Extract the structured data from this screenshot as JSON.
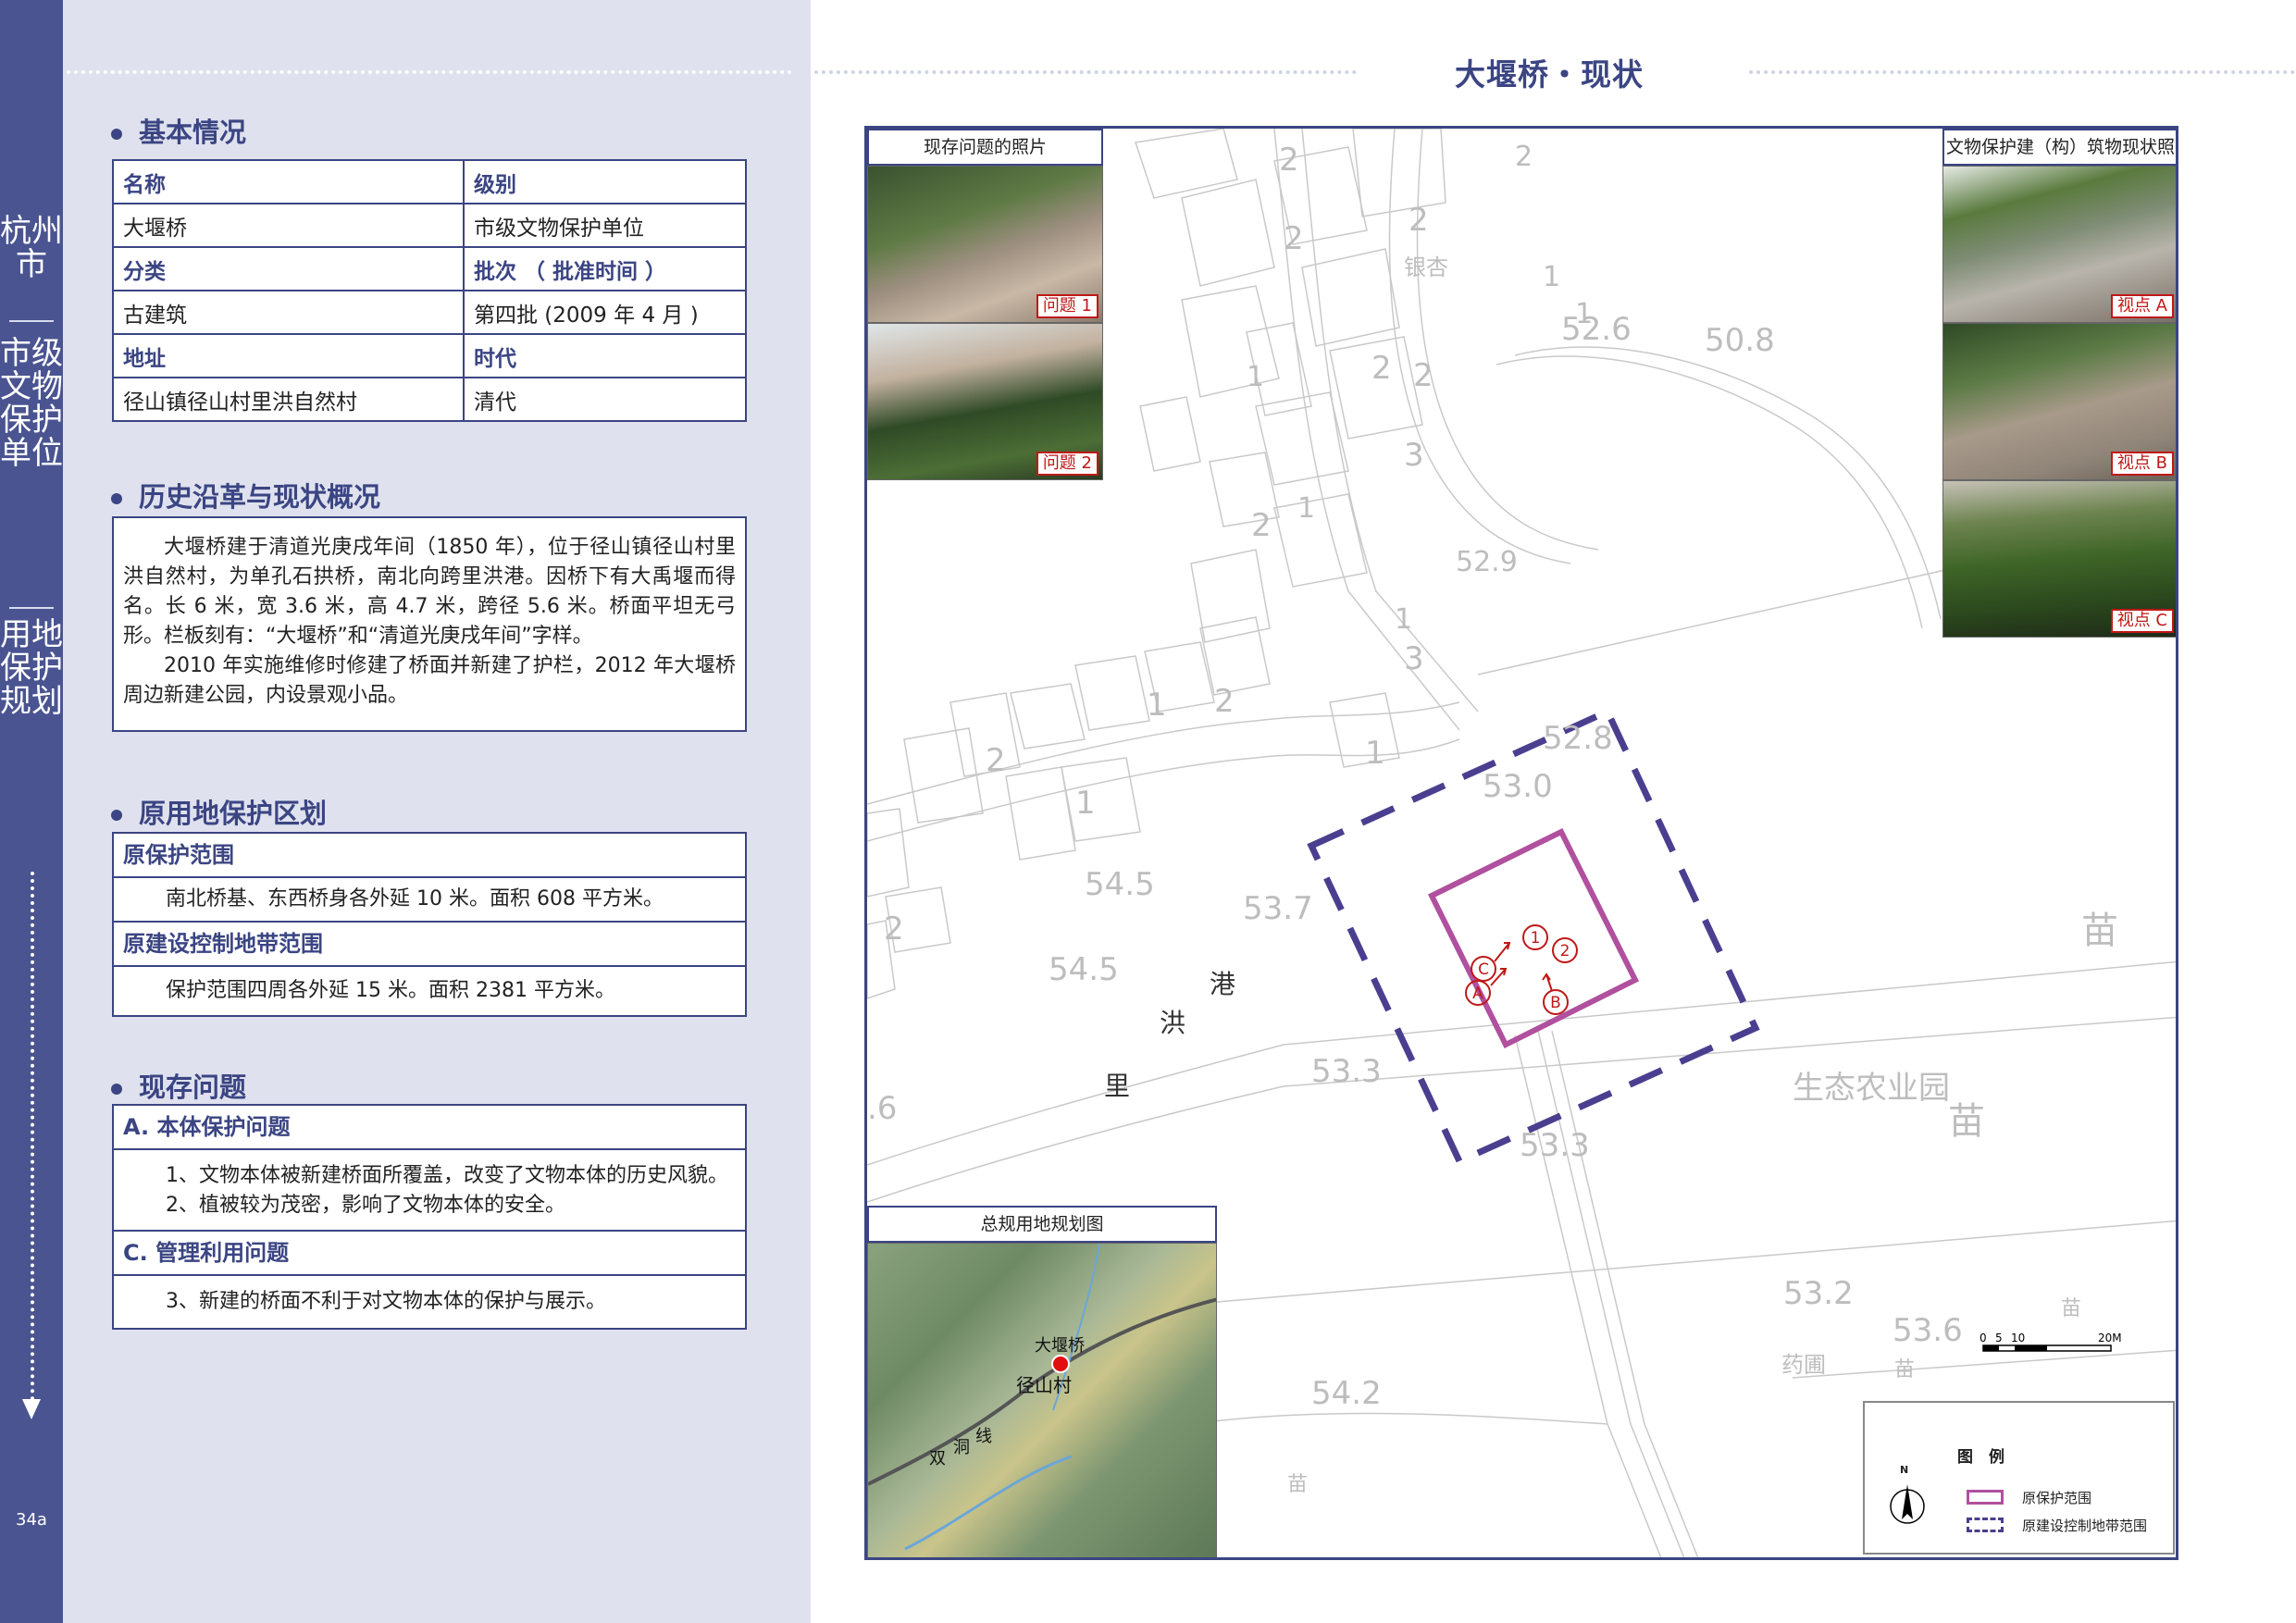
{
  "sidebar": {
    "city": "杭州市",
    "category": "市级文物保护单位",
    "section": "用地保护规划",
    "page_number": "34a"
  },
  "page_title": "大堰桥・现状",
  "basic_info": {
    "heading": "基本情况",
    "rows": [
      {
        "h1": "名称",
        "h2": "级别"
      },
      {
        "v1": "大堰桥",
        "v2": "市级文物保护单位"
      },
      {
        "h1": "分类",
        "h2": "批次 （ 批准时间 ）"
      },
      {
        "v1": "古建筑",
        "v2": "第四批 (2009 年 4 月 )"
      },
      {
        "h1": "地址",
        "h2": "时代"
      },
      {
        "v1": "径山镇径山村里洪自然村",
        "v2": "清代"
      }
    ]
  },
  "history": {
    "heading": "历史沿革与现状概况",
    "p1": "大堰桥建于清道光庚戌年间（1850 年），位于径山镇径山村里洪自然村，为单孔石拱桥，南北向跨里洪港。因桥下有大禹堰而得名。长 6 米，宽 3.6 米，高 4.7 米，跨径 5.6 米。桥面平坦无弓形。栏板刻有：“大堰桥”和“清道光庚戌年间”字样。",
    "p2": "2010 年实施维修时修建了桥面并新建了护栏，2012 年大堰桥周边新建公园，内设景观小品。"
  },
  "original_zones": {
    "heading": "原用地保护区划",
    "protect_title": "原保护范围",
    "protect_text": "南北桥基、东西桥身各外延 10 米。面积 608 平方米。",
    "control_title": "原建设控制地带范围",
    "control_text": "保护范围四周各外延 15 米。面积 2381 平方米。"
  },
  "problems": {
    "heading": "现存问题",
    "a_title": "A. 本体保护问题",
    "a_item1": "1、文物本体被新建桥面所覆盖，改变了文物本体的历史风貌。",
    "a_item2": "2、植被较为茂密，影响了文物本体的安全。",
    "c_title": "C. 管理利用问题",
    "c_item1": "3、新建的桥面不利于对文物本体的保护与展示。"
  },
  "map": {
    "left_photos_title": "现存问题的照片",
    "right_photos_title": "文物保护建（构）筑物现状照片",
    "photo_tags": {
      "p1": "问题 1",
      "p2": "问题 2",
      "va": "视点 A",
      "vb": "视点 B",
      "vc": "视点 C"
    },
    "inset_title": "总规用地规划图",
    "inset_labels": {
      "bridge": "大堰桥",
      "village": "径山村",
      "road_1": "双",
      "road_2": "洞",
      "road_3": "线"
    },
    "river_chars": [
      "里",
      "洪",
      "港"
    ],
    "place_labels": {
      "eco_park": "生态农业园",
      "yaopu": "药圃",
      "ginkgo": "银杏",
      "miao": "苗"
    },
    "elevations": [
      "52.6",
      "50.8",
      "52.9",
      "52.8",
      "53.0",
      "54.5",
      "53.7",
      "54.5",
      "53.3",
      "53.3",
      "53.2",
      "53.6",
      "54.2",
      ".6"
    ],
    "floor_numbers": [
      "1",
      "2",
      "3"
    ],
    "markers": [
      "1",
      "2",
      "A",
      "B",
      "C"
    ],
    "scale": {
      "ticks": [
        "0",
        "5",
        "10",
        "20M"
      ]
    },
    "legend": {
      "title": "图　例",
      "north": "N",
      "item1": "原保护范围",
      "item2": "原建设控制地带范围",
      "color1": "#b0509e",
      "color2": "#4a3f8f"
    }
  },
  "colors": {
    "accent": "#3b4583",
    "sidebar": "#4a5490",
    "panel": "#dfe2ee",
    "warning": "#c01818"
  }
}
